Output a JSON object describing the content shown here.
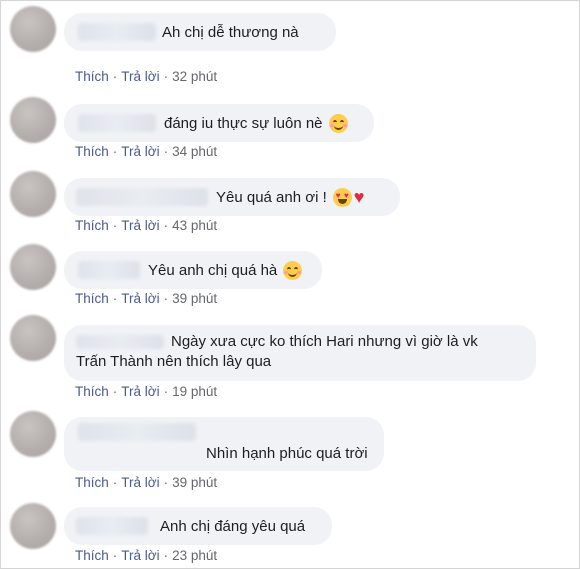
{
  "actions": {
    "like": "Thích",
    "reply": "Trả lời",
    "separator": "·"
  },
  "comments": [
    {
      "text": "Ah chị dễ thương nà",
      "time": "32 phút"
    },
    {
      "text": "đáng iu thực sự luôn nè",
      "time": "34 phút",
      "emoji": "smiling-face-icon"
    },
    {
      "text": "Yêu quá anh ơi !",
      "time": "43 phút",
      "emoji": "heart-eyes-icon"
    },
    {
      "text": "Yêu anh chị quá hà",
      "time": "39 phút",
      "emoji": "smiling-face-icon"
    },
    {
      "line1": "Ngày xưa cực ko thích Hari nhưng vì giờ là vk",
      "line2": "Trấn Thành nên thích lây qua",
      "time": "19 phút"
    },
    {
      "text": "Nhìn hạnh phúc quá trời",
      "time": "39 phút"
    },
    {
      "text": "Anh chị đáng yêu quá",
      "time": "23 phút"
    }
  ],
  "colors": {
    "bubble": "#f1f2f5",
    "meta": "#65676b",
    "action": "#4a5a8c"
  }
}
